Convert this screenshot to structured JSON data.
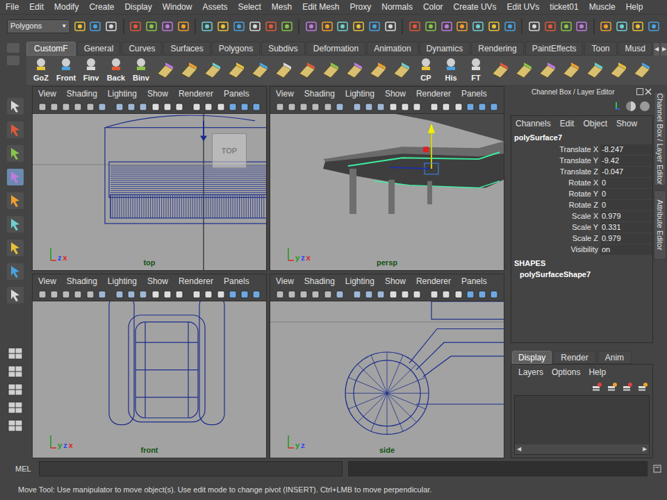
{
  "menu_bar": [
    "File",
    "Edit",
    "Modify",
    "Create",
    "Display",
    "Window",
    "Assets",
    "Select",
    "Mesh",
    "Edit Mesh",
    "Proxy",
    "Normals",
    "Color",
    "Create UVs",
    "Edit UVs",
    "ticket01",
    "Muscle",
    "Help"
  ],
  "status_line": {
    "mode": "Polygons",
    "arrow": "▼"
  },
  "shelf": {
    "tabs": [
      {
        "label": "CustomF",
        "selected": true
      },
      {
        "label": "General",
        "selected": false
      },
      {
        "label": "Curves",
        "selected": false
      },
      {
        "label": "Surfaces",
        "selected": false
      },
      {
        "label": "Polygons",
        "selected": false
      },
      {
        "label": "Subdivs",
        "selected": false
      },
      {
        "label": "Deformation",
        "selected": false
      },
      {
        "label": "Animation",
        "selected": false
      },
      {
        "label": "Dynamics",
        "selected": false
      },
      {
        "label": "Rendering",
        "selected": false
      },
      {
        "label": "PaintEffects",
        "selected": false
      },
      {
        "label": "Toon",
        "selected": false
      },
      {
        "label": "Musd",
        "selected": false
      }
    ],
    "scroll": [
      "◀",
      "▶"
    ],
    "items": [
      {
        "kind": "labeled",
        "label": "GoZ"
      },
      {
        "kind": "labeled",
        "label": "Front"
      },
      {
        "kind": "labeled",
        "label": "Finv"
      },
      {
        "kind": "labeled",
        "label": "Back"
      },
      {
        "kind": "labeled",
        "label": "Binv"
      },
      {
        "kind": "icon"
      },
      {
        "kind": "icon"
      },
      {
        "kind": "icon"
      },
      {
        "kind": "icon"
      },
      {
        "kind": "icon"
      },
      {
        "kind": "icon"
      },
      {
        "kind": "icon"
      },
      {
        "kind": "icon"
      },
      {
        "kind": "icon"
      },
      {
        "kind": "icon"
      },
      {
        "kind": "icon"
      },
      {
        "kind": "labeled",
        "label": "CP"
      },
      {
        "kind": "labeled",
        "label": "His"
      },
      {
        "kind": "labeled",
        "label": "FT"
      },
      {
        "kind": "icon"
      },
      {
        "kind": "icon"
      },
      {
        "kind": "icon"
      },
      {
        "kind": "icon"
      },
      {
        "kind": "icon"
      },
      {
        "kind": "icon"
      },
      {
        "kind": "icon"
      }
    ]
  },
  "viewport_menu": [
    "View",
    "Shading",
    "Lighting",
    "Show",
    "Renderer",
    "Panels"
  ],
  "viewports": [
    {
      "label": "top",
      "cube": "TOP",
      "axes": [
        {
          "label": "z",
          "color": "#2a3cff"
        },
        {
          "label": "x",
          "color": "#e02020"
        }
      ]
    },
    {
      "label": "persp",
      "cube": "",
      "axes": [
        {
          "label": "y",
          "color": "#1a9a1a"
        },
        {
          "label": "z",
          "color": "#2a3cff"
        },
        {
          "label": "x",
          "color": "#e02020"
        }
      ]
    },
    {
      "label": "front",
      "cube": "",
      "axes": [
        {
          "label": "y",
          "color": "#1a9a1a"
        },
        {
          "label": "z",
          "color": "#2a3cff"
        },
        {
          "label": "x",
          "color": "#e02020"
        }
      ]
    },
    {
      "label": "side",
      "cube": "",
      "axes": [
        {
          "label": "y",
          "color": "#1a9a1a"
        },
        {
          "label": "z",
          "color": "#2a3cff"
        }
      ]
    }
  ],
  "channel_box": {
    "title": "Channel Box / Layer Editor",
    "menus": [
      "Channels",
      "Edit",
      "Object",
      "Show"
    ],
    "object": "polySurface7",
    "attributes": [
      {
        "name": "Translate X",
        "value": "-8.247"
      },
      {
        "name": "Translate Y",
        "value": "-9.42"
      },
      {
        "name": "Translate Z",
        "value": "-0.047"
      },
      {
        "name": "Rotate X",
        "value": "0"
      },
      {
        "name": "Rotate Y",
        "value": "0"
      },
      {
        "name": "Rotate Z",
        "value": "0"
      },
      {
        "name": "Scale X",
        "value": "0.979"
      },
      {
        "name": "Scale Y",
        "value": "0.331"
      },
      {
        "name": "Scale Z",
        "value": "0.979"
      },
      {
        "name": "Visibility",
        "value": "on"
      }
    ],
    "shapes_header": "SHAPES",
    "shape": "polySurfaceShape7"
  },
  "layer_editor": {
    "tabs": [
      {
        "label": "Display",
        "selected": true
      },
      {
        "label": "Render",
        "selected": false
      },
      {
        "label": "Anim",
        "selected": false
      }
    ],
    "menus": [
      "Layers",
      "Options",
      "Help"
    ],
    "scroll": [
      "◀",
      "▶"
    ]
  },
  "side_tabs": [
    "Channel Box / Layer Editor",
    "Attribute Editor"
  ],
  "command_line": {
    "label": "MEL"
  },
  "help_line": "Move Tool: Use manipulator to move object(s). Use edit mode to change pivot (INSERT).  Ctrl+LMB to move perpendicular."
}
